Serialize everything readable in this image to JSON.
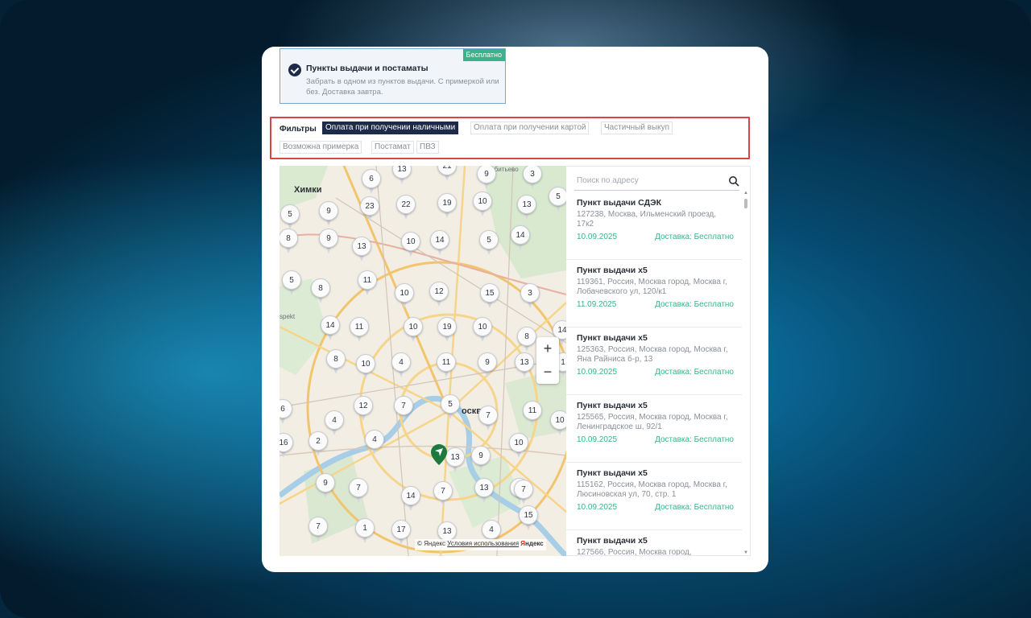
{
  "delivery_option": {
    "title": "Пункты выдачи и постаматы",
    "description": "Забрать в одном из пунктов выдачи. С примеркой или без. Доставка завтра.",
    "badge": "Бесплатно",
    "checked": true
  },
  "filters": {
    "label": "Фильтры",
    "chips": [
      {
        "label": "Оплата при получении наличными",
        "active": true
      },
      {
        "label": "Оплата при получении картой",
        "active": false
      },
      {
        "label": "Частичный выкуп",
        "active": false
      },
      {
        "label": "Возможна примерка",
        "active": false
      },
      {
        "label": "Постамат",
        "active": false
      },
      {
        "label": "ПВЗ",
        "active": false
      }
    ]
  },
  "map": {
    "labels": {
      "khimki": "Химки",
      "moskva": "осква",
      "chelobityevo": "Челобитьево",
      "prospekt": "spekt"
    },
    "zoom_in": "+",
    "zoom_out": "−",
    "copyright": "© Яндекс",
    "terms": "Условия использования",
    "brand_ya": "Я",
    "brand_rest": "ндекс",
    "cluster_counts": [
      "21",
      "13",
      "6",
      "9",
      "3",
      "5",
      "9",
      "23",
      "22",
      "19",
      "10",
      "13",
      "5",
      "14",
      "8",
      "9",
      "10",
      "14",
      "5",
      "13",
      "5",
      "11",
      "8",
      "10",
      "12",
      "15",
      "3",
      "14",
      "11",
      "10",
      "19",
      "10",
      "8",
      "14",
      "8",
      "10",
      "4",
      "11",
      "9",
      "13",
      "1",
      "12",
      "7",
      "5",
      "7",
      "11",
      "10",
      "4",
      "2",
      "4",
      "16",
      "6",
      "13",
      "9",
      "10",
      "3",
      "9",
      "7",
      "14",
      "7",
      "13",
      "7",
      "15",
      "17",
      "13",
      "4",
      "7",
      "1"
    ]
  },
  "search": {
    "placeholder": "Поиск по адресу"
  },
  "points": [
    {
      "name": "Пункт выдачи СДЭК",
      "address": "127238, Москва, Ильменский проезд, 17к2",
      "date": "10.09.2025",
      "delivery": "Доставка: Бесплатно"
    },
    {
      "name": "Пункт выдачи x5",
      "address": "119361, Россия, Москва город, Москва г, Лобачевского ул, 120/к1",
      "date": "11.09.2025",
      "delivery": "Доставка: Бесплатно"
    },
    {
      "name": "Пункт выдачи x5",
      "address": "125363, Россия, Москва город, Москва г, Яна Райниса б-р, 13",
      "date": "10.09.2025",
      "delivery": "Доставка: Бесплатно"
    },
    {
      "name": "Пункт выдачи x5",
      "address": "125565, Россия, Москва город, Москва г, Ленинградское ш, 92/1",
      "date": "10.09.2025",
      "delivery": "Доставка: Бесплатно"
    },
    {
      "name": "Пункт выдачи x5",
      "address": "115162, Россия, Москва город, Москва г, Люсиновская ул, 70, стр. 1",
      "date": "10.09.2025",
      "delivery": "Доставка: Бесплатно"
    },
    {
      "name": "Пункт выдачи x5",
      "address": "127566, Россия, Москва город,",
      "date": "",
      "delivery": ""
    }
  ],
  "colors": {
    "accent_green": "#3bb38a",
    "dark_navy": "#1e2a4a",
    "highlight_red": "#d94545"
  }
}
